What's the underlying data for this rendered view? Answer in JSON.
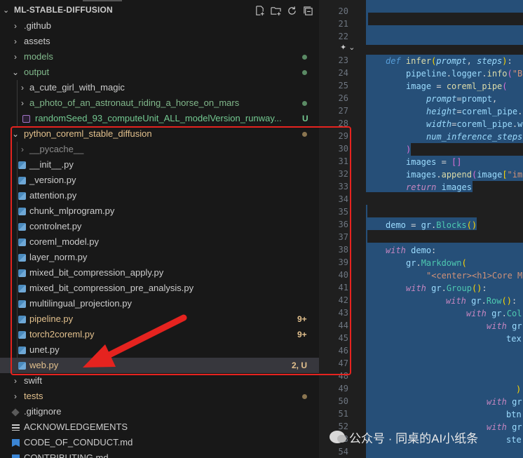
{
  "explorer": {
    "title": "ML-STABLE-DIFFUSION",
    "actions": [
      "new-file",
      "new-folder",
      "refresh",
      "collapse-all"
    ],
    "rows": [
      {
        "label": "ML-STABLE-DIFFUSION"
      },
      {
        "label": ".github"
      },
      {
        "label": "assets"
      },
      {
        "label": "models"
      },
      {
        "label": "output"
      },
      {
        "label": "a_cute_girl_with_magic"
      },
      {
        "label": "a_photo_of_an_astronaut_riding_a_horse_on_mars"
      },
      {
        "label": "randomSeed_93_computeUnit_ALL_modelVersion_runway...",
        "badge": "U"
      },
      {
        "label": "python_coreml_stable_diffusion"
      },
      {
        "label": "__pycache__"
      },
      {
        "label": "__init__.py"
      },
      {
        "label": "_version.py"
      },
      {
        "label": "attention.py"
      },
      {
        "label": "chunk_mlprogram.py"
      },
      {
        "label": "controlnet.py"
      },
      {
        "label": "coreml_model.py"
      },
      {
        "label": "layer_norm.py"
      },
      {
        "label": "mixed_bit_compression_apply.py"
      },
      {
        "label": "mixed_bit_compression_pre_analysis.py"
      },
      {
        "label": "multilingual_projection.py"
      },
      {
        "label": "pipeline.py",
        "badge": "9+"
      },
      {
        "label": "torch2coreml.py",
        "badge": "9+"
      },
      {
        "label": "unet.py"
      },
      {
        "label": "web.py",
        "badge": "2, U"
      },
      {
        "label": "swift"
      },
      {
        "label": "tests"
      },
      {
        "label": ".gitignore"
      },
      {
        "label": "ACKNOWLEDGEMENTS"
      },
      {
        "label": "CODE_OF_CONDUCT.md"
      },
      {
        "label": "CONTRIBUTING.md"
      }
    ]
  },
  "editor": {
    "line_numbers": [
      "20",
      "21",
      "22",
      "23",
      "24",
      "25",
      "26",
      "27",
      "28",
      "29",
      "30",
      "31",
      "32",
      "33",
      "34",
      "35",
      "36",
      "37",
      "38",
      "39",
      "40",
      "41",
      "42",
      "43",
      "44",
      "45",
      "46",
      "47",
      "48",
      "49",
      "50",
      "51",
      "52",
      "53",
      "54"
    ],
    "code": {
      "l23_def": "def",
      "l23_name": "infer",
      "l23_p1": "prompt",
      "l23_p2": "steps",
      "l24_a": "pipeline",
      "l24_b": "logger",
      "l24_c": "info",
      "l24_d": "\"B",
      "l25_a": "image",
      "l25_b": "coreml_pipe",
      "l26_a": "prompt",
      "l26_b": "prompt",
      "l27_a": "height",
      "l27_b": "coreml_pipe",
      "l28_a": "width",
      "l28_b": "coreml_pipe",
      "l28_c": "w",
      "l29_a": "num_inference_steps",
      "l31_a": "images",
      "l32_a": "images",
      "l32_b": "append",
      "l32_c": "image",
      "l32_d": "\"im",
      "l33_ret": "return",
      "l33_a": "images",
      "l36_a": "demo",
      "l36_b": "gr",
      "l36_c": "Blocks",
      "l38_with": "with",
      "l38_a": "demo",
      "l39_a": "gr",
      "l39_b": "Markdown",
      "l40_a": "\"<center><h1>Core M",
      "l41_with": "with",
      "l41_a": "gr",
      "l41_b": "Group",
      "l42_with": "with",
      "l42_a": "gr",
      "l42_b": "Row",
      "l43_with": "with",
      "l43_a": "gr",
      "l43_b": "Col",
      "l44_with": "with",
      "l44_a": "gr",
      "l45_a": "tex",
      "l50_with": "with",
      "l50_a": "gr",
      "l51_a": "btn",
      "l52_with": "with",
      "l52_a": "gr",
      "l53_a": "ste"
    }
  },
  "watermark": {
    "text": "公众号 · 同桌的AI小纸条"
  },
  "colors": {
    "annotation": "#e5231f",
    "modified": "#e2c08d",
    "untracked": "#73c991",
    "folder_green": "#81b88b",
    "selection": "#264f78"
  }
}
